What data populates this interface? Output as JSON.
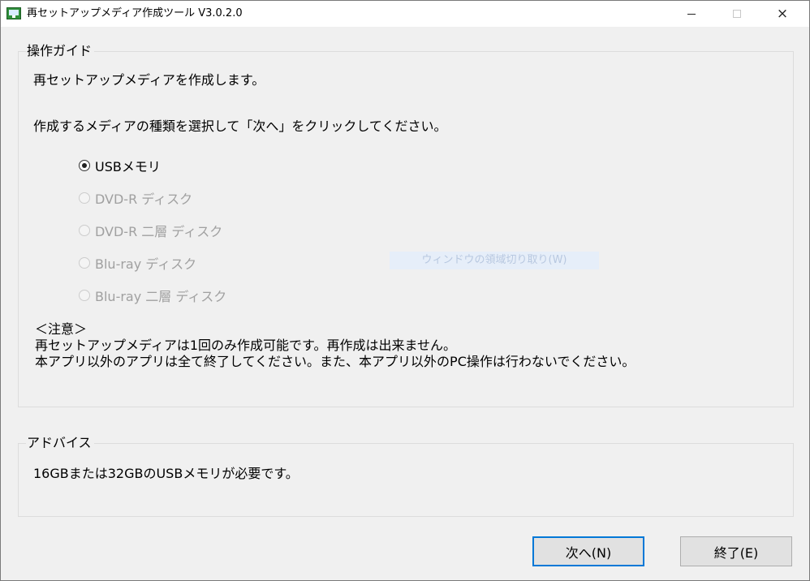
{
  "window": {
    "title": "再セットアップメディア作成ツール V3.0.2.0",
    "controls": {
      "minimize": "minimize-icon",
      "maximize": "maximize-icon",
      "close": "×"
    }
  },
  "guide": {
    "legend": "操作ガイド",
    "line1": "再セットアップメディアを作成します。",
    "line2": "作成するメディアの種類を選択して「次へ」をクリックしてください。",
    "options": [
      {
        "label": "USBメモリ",
        "checked": true,
        "enabled": true
      },
      {
        "label": "DVD-R ディスク",
        "checked": false,
        "enabled": false
      },
      {
        "label": "DVD-R 二層 ディスク",
        "checked": false,
        "enabled": false
      },
      {
        "label": "Blu-ray ディスク",
        "checked": false,
        "enabled": false
      },
      {
        "label": "Blu-ray 二層 ディスク",
        "checked": false,
        "enabled": false
      }
    ],
    "note_title": "＜注意＞",
    "note_line1": "再セットアップメディアは1回のみ作成可能です。再作成は出来ません。",
    "note_line2": "本アプリ以外のアプリは全て終了してください。また、本アプリ以外のPC操作は行わないでください。"
  },
  "tooltip": "ウィンドウの領域切り取り(W)",
  "advice": {
    "legend": "アドバイス",
    "text": "16GBまたは32GBのUSBメモリが必要です。"
  },
  "buttons": {
    "next": "次へ(N)",
    "exit": "終了(E)"
  }
}
